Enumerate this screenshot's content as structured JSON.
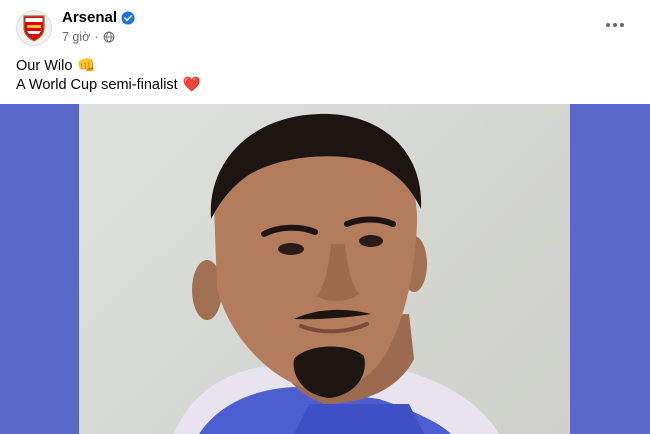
{
  "post": {
    "author": "Arsenal",
    "verified": true,
    "time": "7 giờ",
    "audience_icon": "globe-icon",
    "more_icon": "more-options-icon",
    "text_lines": [
      {
        "text": "Our Wilo",
        "emoji": "👊"
      },
      {
        "text": "A World Cup semi-finalist",
        "emoji": "❤️"
      }
    ]
  },
  "media": {
    "image_icon": "portrait-photo",
    "background_color": "#5a68c9"
  },
  "colors": {
    "verified_badge": "#1b74e4",
    "meta_text": "#65676b",
    "heart": "#e41e3f",
    "arsenal_red": "#db0007"
  }
}
